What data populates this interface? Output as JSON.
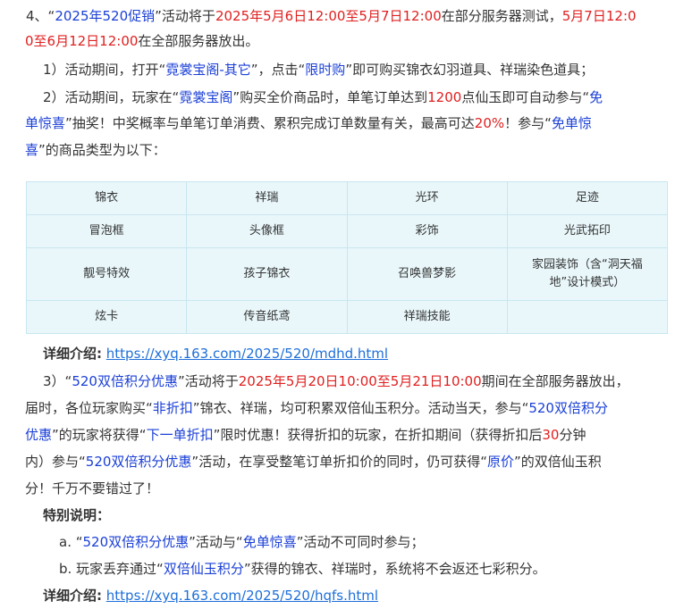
{
  "item4": {
    "num": "4、",
    "q1": "“",
    "name": "2025年520促销",
    "q2": "”",
    "t1": "活动将于",
    "date1": "2025年5月6日12:00至5月7日12:00",
    "t2": "在部分服务器测试，",
    "date2a": "5月7日12:0",
    "date2b": "0至6月12日12:00",
    "t3": "在全部服务器放出。"
  },
  "sub1": {
    "prefix": "1）活动期间，打开“",
    "menu": "霓裳宝阁-其它",
    "t1": "”，点击“",
    "btn": "限时购",
    "t2": "”即可购买锦衣幻羽道具、祥瑞染色道具；"
  },
  "sub2": {
    "prefix": "2）活动期间，玩家在“",
    "shop": "霓裳宝阁",
    "t1": "”购买全价商品时，单笔订单达到",
    "amount": "1200",
    "t2": "点仙玉即可自动参与“",
    "prize_a": "免",
    "prize_b": "单惊喜",
    "t3": "”抽奖！中奖概率与单笔订单消费、累积完成订单数量有关，最高可达",
    "pct": "20%",
    "t4": "！参与“",
    "prize2_a": "免单惊",
    "prize2_b": "喜",
    "t5": "”的商品类型为以下："
  },
  "table": {
    "rows": [
      [
        "锦衣",
        "祥瑞",
        "光环",
        "足迹"
      ],
      [
        "冒泡框",
        "头像框",
        "彩饰",
        "光武拓印"
      ],
      [
        "靓号特效",
        "孩子锦衣",
        "召唤兽梦影",
        "家园装饰（含“洞天福地”设计模式）"
      ],
      [
        "炫卡",
        "传音纸鸢",
        "祥瑞技能",
        ""
      ]
    ]
  },
  "detail1": {
    "label": "详细介绍:",
    "url": "https://xyq.163.com/2025/520/mdhd.html"
  },
  "sub3": {
    "prefix": "3）“",
    "name": "520双倍积分优惠",
    "t1": "”活动将于",
    "date": "2025年5月20日10:00至5月21日10:00",
    "t2": "期间在全部服务器放出，",
    "t3": "届时，各位玩家购买“",
    "nodisc": "非折扣",
    "t4": "”锦衣、祥瑞，均可积累双倍仙玉积分。活动当天，参与“",
    "name2a": "520双倍积分",
    "name2b": "优惠",
    "t5": "”的玩家将获得“",
    "next": "下一单折扣",
    "t6": "”限时优惠！获得折扣的玩家，在折扣期间（获得折扣后",
    "mins": "30",
    "t7": "分钟",
    "t8": "内）参与“",
    "name3": "520双倍积分优惠",
    "t9": "”活动，在享受整笔订单折扣价的同时，仍可获得“",
    "orig": "原价",
    "t10": "”的双倍仙玉积",
    "t11": "分！千万不要错过了！"
  },
  "notes": {
    "label": "特别说明：",
    "a_prefix": "a. “",
    "a_name": "520双倍积分优惠",
    "a_t1": "”活动与“",
    "a_name2": "免单惊喜",
    "a_t2": "”活动不可同时参与；",
    "b_prefix": "b. 玩家丢弃通过“",
    "b_name": "双倍仙玉积分",
    "b_t1": "”获得的锦衣、祥瑞时，系统将不会返还七彩积分。"
  },
  "detail2": {
    "label": "详细介绍:",
    "url": "https://xyq.163.com/2025/520/hqfs.html"
  }
}
